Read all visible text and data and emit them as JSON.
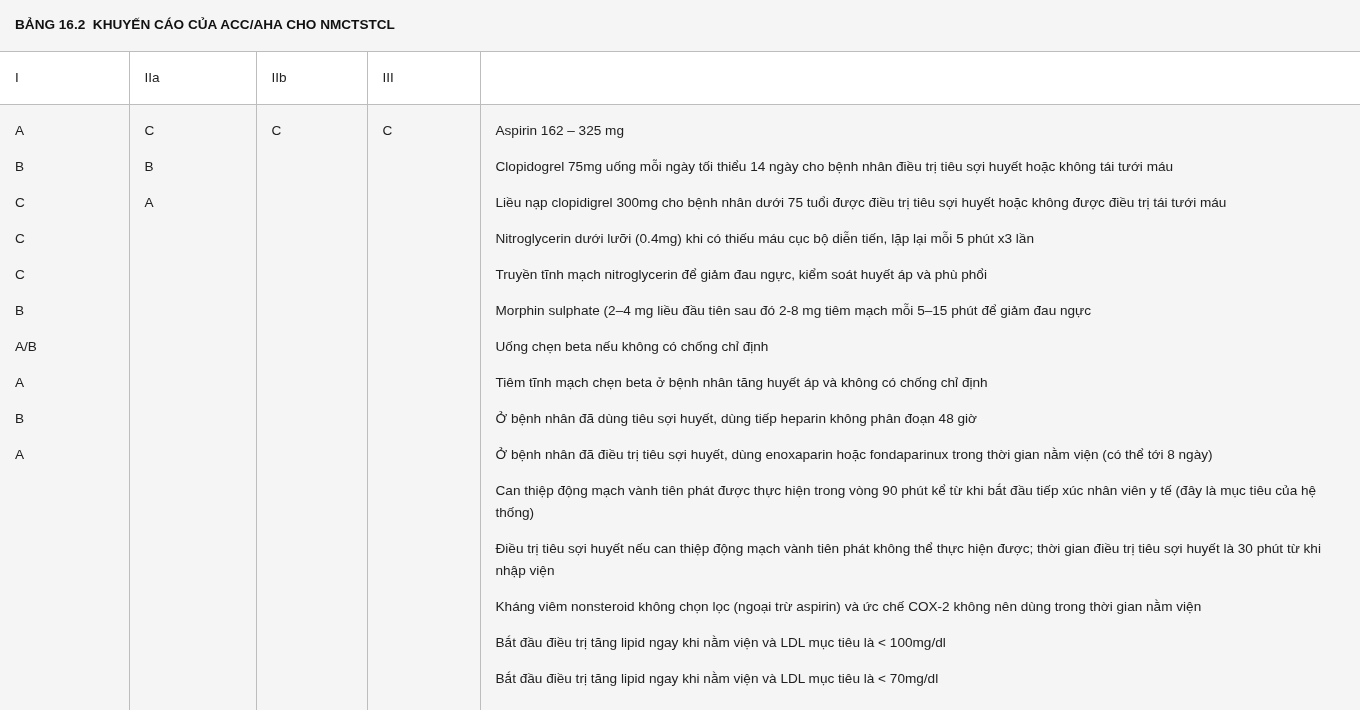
{
  "title": "BẢNG 16.2  KHUYẾN CÁO CỦA ACC/AHA CHO NMCTSTCL",
  "table": {
    "columns": [
      "I",
      "IIa",
      "IIb",
      "III",
      ""
    ],
    "class_columns": [
      [
        "A",
        "B",
        "C",
        "C",
        "C",
        "B",
        "A/B",
        "A",
        "B",
        "A"
      ],
      [
        "C",
        "B",
        "A"
      ],
      [
        "C"
      ],
      [
        "C"
      ]
    ],
    "recommendations": [
      "Aspirin 162 – 325 mg",
      "Clopidogrel 75mg uống mỗi ngày tối thiểu 14 ngày cho bệnh nhân điều trị tiêu sợi huyết hoặc không tái tưới máu",
      "Liều nạp clopidigrel 300mg cho bệnh nhân dưới 75 tuổi được điều trị tiêu sợi huyết hoặc không được điều trị tái tưới máu",
      "Nitroglycerin dưới lưỡi (0.4mg) khi có thiếu máu cục bộ diễn tiến, lặp lại mỗi 5 phút x3 lần",
      "Truyền tĩnh mạch nitroglycerin để giảm đau ngực, kiểm soát huyết áp và phù phổi",
      "Morphin sulphate (2–4 mg liều đầu tiên sau đó 2-8 mg tiêm mạch mỗi 5–15 phút để giảm đau ngực",
      "Uống chẹn beta nếu không có chống chỉ định",
      "Tiêm tĩnh mạch chẹn beta ở bệnh nhân tăng huyết áp và không có chống chỉ định",
      "Ở bệnh nhân đã dùng tiêu sợi huyết, dùng tiếp heparin không phân đoạn 48 giờ",
      "Ở bệnh nhân đã điều trị tiêu sợi huyết, dùng enoxaparin hoặc fondaparinux trong thời gian nằm viện (có thể tới 8 ngày)",
      "Can thiệp động mạch vành tiên phát được thực hiện trong vòng 90 phút kể từ khi bắt đầu tiếp xúc nhân viên y tế (đây là mục tiêu của hệ thống)",
      "Điều trị tiêu sợi huyết nếu can thiệp động mạch vành tiên phát không thể thực hiện được; thời gian điều trị tiêu sợi huyết là 30 phút từ khi nhập viện",
      "Kháng viêm nonsteroid không chọn lọc (ngoại trừ aspirin) và ức chế COX-2 không nên dùng trong thời gian nằm viện",
      "Bắt đầu điều trị tăng lipid ngay khi nằm viện và LDL mục tiêu là < 100mg/dl",
      "Bắt đầu điều trị tăng lipid ngay khi nằm viện và LDL mục tiêu là < 70mg/dl"
    ]
  }
}
